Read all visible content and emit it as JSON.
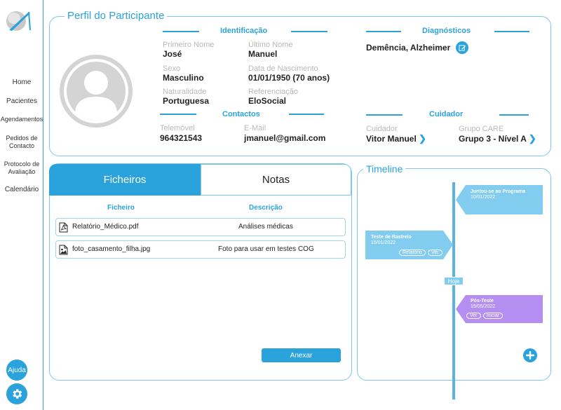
{
  "sidebar": {
    "logo_icon": "care-logo-icon",
    "items": [
      {
        "label": "Home"
      },
      {
        "label": "Pacientes"
      },
      {
        "label": "Agendamentos"
      },
      {
        "label": "Pedidos de Contacto"
      },
      {
        "label": "Protocolo de Avaliação"
      },
      {
        "label": "Calendário"
      }
    ],
    "help_label": "Ajuda",
    "settings_icon": "gear-icon"
  },
  "profile": {
    "title": "Perfil do Participante",
    "avatar_icon": "user-avatar-icon",
    "identification": {
      "title": "Identificação",
      "first_name_label": "Primeiro Nome",
      "first_name": "José",
      "last_name_label": "Último Nome",
      "last_name": "Manuel",
      "sex_label": "Sexo",
      "sex": "Masculino",
      "birth_label": "Data de Nascimento",
      "birth": "01/01/1950  (70 anos)",
      "origin_label": "Naturalidade",
      "origin": "Portuguesa",
      "referral_label": "Referenciação",
      "referral": "EloSocial"
    },
    "diagnostics": {
      "title": "Diagnósticos",
      "value": "Demência, Alzheimer",
      "edit_icon": "edit-icon"
    },
    "contacts": {
      "title": "Contactos",
      "phone_label": "Telemóvel",
      "phone": "964321543",
      "email_label": "E-Mail",
      "email": "jmanuel@gmail.com"
    },
    "caregiver": {
      "title": "Cuidador",
      "caregiver_label": "Cuidador",
      "caregiver": "Vitor Manuel",
      "group_label": "Grupo CARE",
      "group": "Grupo 3 - Nível A"
    }
  },
  "files": {
    "tabs": [
      {
        "label": "Ficheiros",
        "active": true
      },
      {
        "label": "Notas",
        "active": false
      }
    ],
    "columns": [
      "Ficheiro",
      "Descrição"
    ],
    "rows": [
      {
        "icon": "pdf-file-icon",
        "name": "Relatório_Médico.pdf",
        "description": "Análises médicas"
      },
      {
        "icon": "image-file-icon",
        "name": "foto_casamento_filha.jpg",
        "description": "Foto para usar em testes COG"
      }
    ],
    "attach_label": "Anexar"
  },
  "timeline": {
    "title": "Timeline",
    "today_label": "Hoje",
    "events": [
      {
        "title": "Juntou-se ao Programa",
        "date": "10/01/2022",
        "color": "#82ccf0"
      },
      {
        "title": "Teste de Rastreio",
        "date": "15/01/2022",
        "color": "#82ccf0",
        "buttons": [
          "Relatório",
          "Ver"
        ]
      },
      {
        "title": "Pós-Teste",
        "date": "15/05/2022",
        "color": "#b48ef0",
        "buttons": [
          "Ver",
          "Iniciar"
        ]
      }
    ],
    "add_icon": "plus-icon"
  },
  "colors": {
    "accent": "#2aa3dc",
    "timeline_blue": "#82ccf0",
    "timeline_purple": "#b48ef0"
  }
}
